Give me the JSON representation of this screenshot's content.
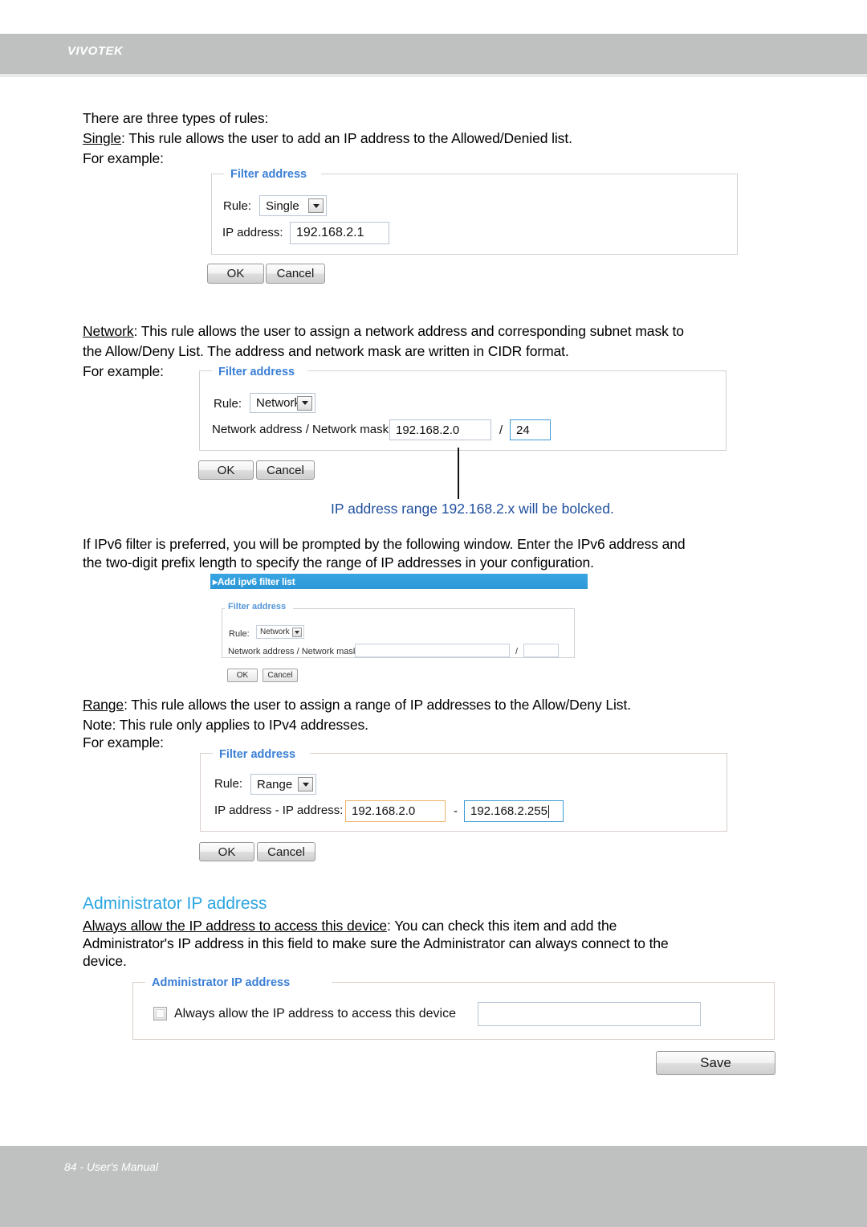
{
  "header": {
    "brand": "VIVOTEK"
  },
  "footer": {
    "text": "84 - User's Manual"
  },
  "intro": {
    "line1": "There are three types of rules:",
    "rule_single_label": "Single",
    "rule_single_desc": ": This rule allows the user to add an IP address to the Allowed/Denied list.",
    "for_example": "For example:"
  },
  "panel_single": {
    "legend": "Filter address",
    "rule_label": "Rule:",
    "rule_value": "Single",
    "ip_label": "IP address:",
    "ip_value": "192.168.2.1",
    "ok_label": "OK",
    "cancel_label": "Cancel"
  },
  "network_section": {
    "rule_label": "Network",
    "desc_line1": ": This rule allows the user to assign a network address and corresponding subnet mask to",
    "desc_line2": "the Allow/Deny List. The address and network mask are written in CIDR format.",
    "for_example": "For example:"
  },
  "panel_network": {
    "legend": "Filter address",
    "rule_label": "Rule:",
    "rule_value": "Network",
    "addr_label": "Network address / Network mask:",
    "addr_value": "192.168.2.0",
    "slash": "/",
    "mask_value": "24",
    "ok_label": "OK",
    "cancel_label": "Cancel"
  },
  "blocked_caption": "IP address range 192.168.2.x will be bolcked.",
  "ipv6_intro": {
    "line1": "If IPv6 filter is preferred, you will be prompted by the following window. Enter the IPv6 address and",
    "line2": "the two-digit prefix length to specify the range of IP addresses in your configuration."
  },
  "ipv6_window": {
    "title": "▸Add ipv6 filter list",
    "legend": "Filter address",
    "rule_label": "Rule:",
    "rule_value": "Network",
    "addr_label": "Network address / Network mask:",
    "addr_value": "",
    "slash": "/",
    "mask_value": "",
    "ok_label": "OK",
    "cancel_label": "Cancel"
  },
  "range_section": {
    "rule_label": "Range",
    "desc_line1": ": This rule allows the user to assign a range of IP addresses to the Allow/Deny List.",
    "desc_line2": "Note: This rule only applies to IPv4 addresses.",
    "for_example": "For example:"
  },
  "panel_range": {
    "legend": "Filter address",
    "rule_label": "Rule:",
    "rule_value": "Range",
    "ip_label": "IP address - IP address:",
    "ip_start": "192.168.2.0",
    "dash": "-",
    "ip_end": "192.168.2.255",
    "ok_label": "OK",
    "cancel_label": "Cancel"
  },
  "admin_section": {
    "heading": "Administrator IP address",
    "body_underlined": "Always allow the IP address to access this device",
    "body_line1_rest": ": You can check this item and add the",
    "body_line2": "Administrator's IP address in this field to make sure the Administrator can always connect to the",
    "body_line3": "device."
  },
  "panel_admin": {
    "legend": "Administrator IP address",
    "checkbox_label": "Always allow the IP address to access this device",
    "input_value": "",
    "save_label": "Save"
  },
  "colors": {
    "brand_bar": "#bfc1c1",
    "legend_blue": "#3a7fd5",
    "heading_blue": "#2ba5e0",
    "caption_blue": "#1f4e9c",
    "titlebar_blue": "#2a9fe0",
    "focus_border": "#3f9ad6",
    "warn_border": "#eeb36a"
  }
}
